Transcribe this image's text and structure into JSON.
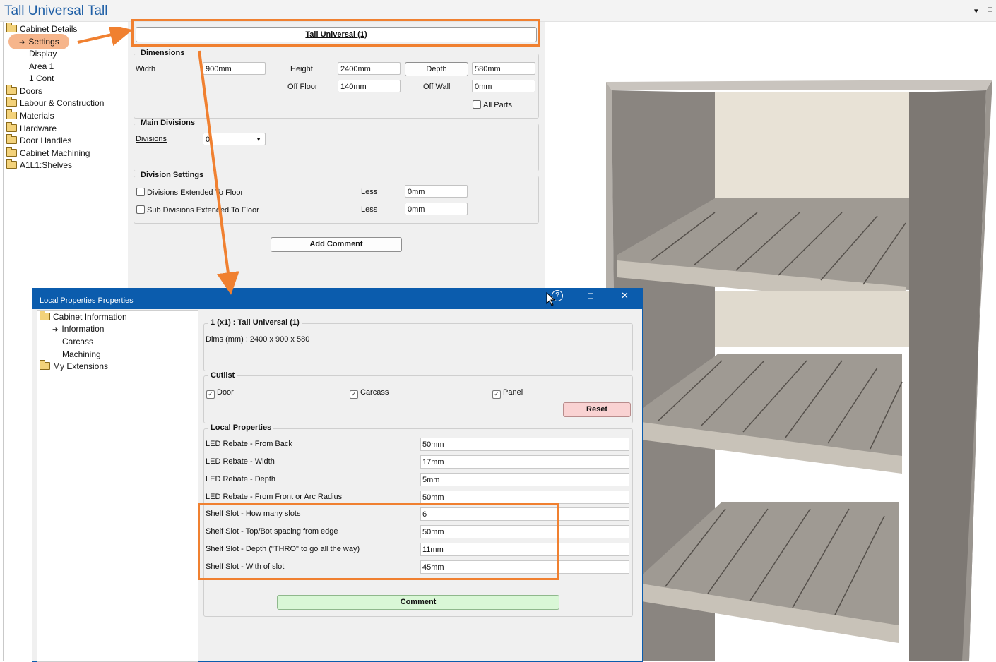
{
  "window": {
    "title": "Tall Universal Tall",
    "dropdown_glyph": "▾",
    "maximize_glyph": "□"
  },
  "tree": {
    "items": [
      {
        "label": "Cabinet Details",
        "icon": "folder-icon"
      },
      {
        "label": "Settings",
        "icon": "arrow-right-icon"
      },
      {
        "label": "Display"
      },
      {
        "label": "Area 1"
      },
      {
        "label": "1 Cont"
      },
      {
        "label": "Doors",
        "icon": "folder-icon"
      },
      {
        "label": "Labour & Construction",
        "icon": "folder-icon"
      },
      {
        "label": "Materials",
        "icon": "folder-icon"
      },
      {
        "label": "Hardware",
        "icon": "folder-icon"
      },
      {
        "label": "Door Handles",
        "icon": "folder-icon"
      },
      {
        "label": "Cabinet Machining",
        "icon": "folder-icon"
      },
      {
        "label": "A1L1:Shelves",
        "icon": "folder-icon"
      }
    ]
  },
  "settings": {
    "cabinet_button": "Tall Universal (1)",
    "dimensions": {
      "title": "Dimensions",
      "width_label": "Width",
      "width_value": "900mm",
      "height_label": "Height",
      "height_value": "2400mm",
      "depth_button": "Depth",
      "depth_value": "580mm",
      "off_floor_label": "Off Floor",
      "off_floor_value": "140mm",
      "off_wall_label": "Off Wall",
      "off_wall_value": "0mm",
      "all_parts_label": "All Parts"
    },
    "main_divisions": {
      "title": "Main Divisions",
      "divisions_label": "Divisions",
      "divisions_value": "0"
    },
    "division_settings": {
      "title": "Division Settings",
      "ext_floor_label": "Divisions Extended To Floor",
      "sub_ext_floor_label": "Sub Divisions Extended To Floor",
      "less_label_1": "Less",
      "less_value_1": "0mm",
      "less_label_2": "Less",
      "less_value_2": "0mm"
    },
    "add_comment_button": "Add Comment"
  },
  "dialog": {
    "title": "Local Properties Properties",
    "help_glyph": "?",
    "maximize_glyph": "□",
    "close_glyph": "✕",
    "tree": [
      {
        "label": "Cabinet Information",
        "icon": "folder-icon"
      },
      {
        "label": "Information",
        "icon": "arrow-right-icon"
      },
      {
        "label": "Carcass"
      },
      {
        "label": "Machining"
      },
      {
        "label": "My Extensions",
        "icon": "folder-icon"
      }
    ],
    "header_group": {
      "title": "1 (x1) : Tall Universal (1)",
      "dims": "Dims (mm) : 2400 x 900 x 580"
    },
    "cutlist": {
      "title": "Cutlist",
      "door": "Door",
      "carcass": "Carcass",
      "panel": "Panel",
      "check_glyph": "✓",
      "reset_button": "Reset"
    },
    "local_properties": {
      "title": "Local Properties",
      "rows": [
        {
          "label": "LED Rebate - From Back",
          "value": "50mm"
        },
        {
          "label": "LED Rebate - Width",
          "value": "17mm"
        },
        {
          "label": "LED Rebate - Depth",
          "value": "5mm"
        },
        {
          "label": "LED Rebate - From Front or Arc Radius",
          "value": "50mm"
        },
        {
          "label": "Shelf Slot - How many slots",
          "value": "6"
        },
        {
          "label": "Shelf Slot - Top/Bot spacing from edge",
          "value": "50mm"
        },
        {
          "label": "Shelf Slot - Depth (\"THRO\" to go all the way)",
          "value": "11mm"
        },
        {
          "label": "Shelf Slot - With of slot",
          "value": "45mm"
        }
      ],
      "comment_button": "Comment"
    }
  },
  "colors": {
    "accent_orange": "#f08030",
    "dialog_title_blue": "#0b5cad",
    "reset_bg": "#f9d2d2",
    "comment_bg": "#d9f7d6"
  }
}
